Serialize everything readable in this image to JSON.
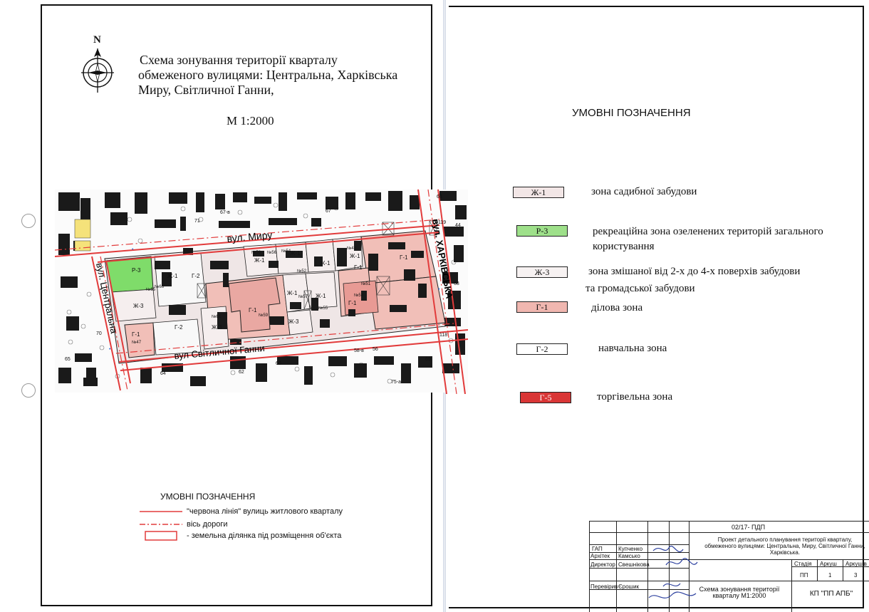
{
  "compass": {
    "north": "N"
  },
  "title": {
    "line1": "Схема зонування території кварталу",
    "line2": "обмеженого вулицями: Центральна, Харківська",
    "line3": "Миру, Світличної Ганни,"
  },
  "scale": "М 1:2000",
  "map": {
    "streets": {
      "myru": "вул. Миру",
      "tsentralna": "вул. Центральна",
      "kharkivska": "вул. ХАРКІВСЬКА",
      "svitlychnoi": "вул Світличної Ганни"
    },
    "zone_labels": {
      "r3": "Р-3",
      "zh1_a": "Ж-1",
      "zh1_b": "Ж-1",
      "zh1_c": "Ж-1",
      "zh1_d": "Ж-1",
      "zh1_e": "Ж-1",
      "zh1_f": "Ж-1",
      "zh1_g": "Ж-1",
      "zh3_a": "Ж-3",
      "zh3_b": "Ж-3",
      "zh3_c": "Ж-3",
      "g1_a": "Г-1",
      "g1_b": "Г-1",
      "g1_c": "Г-1",
      "g1_d": "Г-1",
      "g1_e": "Г-1",
      "g2_a": "Г-2",
      "g2_b": "Г-2"
    },
    "house_numbers": {
      "n66": "№66",
      "n56": "№56",
      "n58": "№58",
      "n54": "№54",
      "n48": "№48",
      "n59": "№59",
      "n61": "№61",
      "n55": "№55",
      "n57": "№57",
      "n53": "№53",
      "n47": "№47",
      "n65": "№65",
      "n52": "№52",
      "n51": "№51"
    },
    "addresses": {
      "a71": "71",
      "a67v": "67-в",
      "a67": "67",
      "a58v": "58-в",
      "a56": "56",
      "a60": "60",
      "a62": "62",
      "a64": "64",
      "a69": "69",
      "a75a": "75-а",
      "a70": "70",
      "a65": "65",
      "a63": "63",
      "a44": "44",
      "a68": "68",
      "a119": "119",
      "a118": "118"
    }
  },
  "legend_left": {
    "title": "УМОВНІ ПОЗНАЧЕННЯ",
    "items": [
      {
        "label": "\"червона лінія\" вулиць житлового кварталу",
        "color": "#e23b3b"
      },
      {
        "label": "вісь дороги",
        "color": "#e23b3b"
      },
      {
        "label": "- земельна ділянка під розміщення об'єкта",
        "color": "#e23b3b"
      }
    ]
  },
  "legend_right": {
    "title": "УМОВНІ ПОЗНАЧЕННЯ",
    "items": [
      {
        "code": "Ж-1",
        "desc": "зона садибної забудови",
        "fill": "#f2e6e6",
        "text": "#222"
      },
      {
        "code": "Р-3",
        "desc1": "рекреаційна зона озеленених територій загального",
        "desc2": "користування",
        "fill": "#9ee08a",
        "text": "#222"
      },
      {
        "code": "Ж-3",
        "desc1": "зона змішаної від 2-х до 4-х поверхів забудови",
        "desc2": "та громадської забудови",
        "fill": "#f7f2f2",
        "text": "#222"
      },
      {
        "code": "Г-1",
        "desc": "ділова зона",
        "fill": "#f0b7b0",
        "text": "#222"
      },
      {
        "code": "Г-2",
        "desc": "навчальна зона",
        "fill": "#ffffff",
        "text": "#222"
      },
      {
        "code": "Г-5",
        "desc": "торгівельна зона",
        "fill": "#d93636",
        "text": "#ffffff"
      }
    ]
  },
  "stamp": {
    "code": "02/17- ПДП",
    "roles": {
      "gap": "ГАП",
      "architect": "Архітек",
      "director": "Директор",
      "checker": "Перевірив"
    },
    "names": {
      "gap": "Купченко",
      "architect": "Камсько",
      "director": "Свешнікова",
      "checker": "Єрошик"
    },
    "project": "Проект детального планування території кварталу, обмеженого вулицями: Центральна, Миру, Світличної Ганни, Харківська.",
    "stage_h": "Стадія",
    "sheet_h": "Аркуш",
    "sheets_h": "Аркушів",
    "stage": "ПП",
    "sheet": "1",
    "sheets": "3",
    "drawing": "Схема зонування території кварталу М1:2000",
    "org": "КП \"ПП АПБ\""
  },
  "colors": {
    "red_line": "#e23b3b",
    "g1_fill": "#f1bfb8",
    "g1_dark": "#e89a94",
    "r3_fill": "#7fdc6a",
    "zh_fill": "#f6eeee",
    "building": "#1a1a1a"
  }
}
